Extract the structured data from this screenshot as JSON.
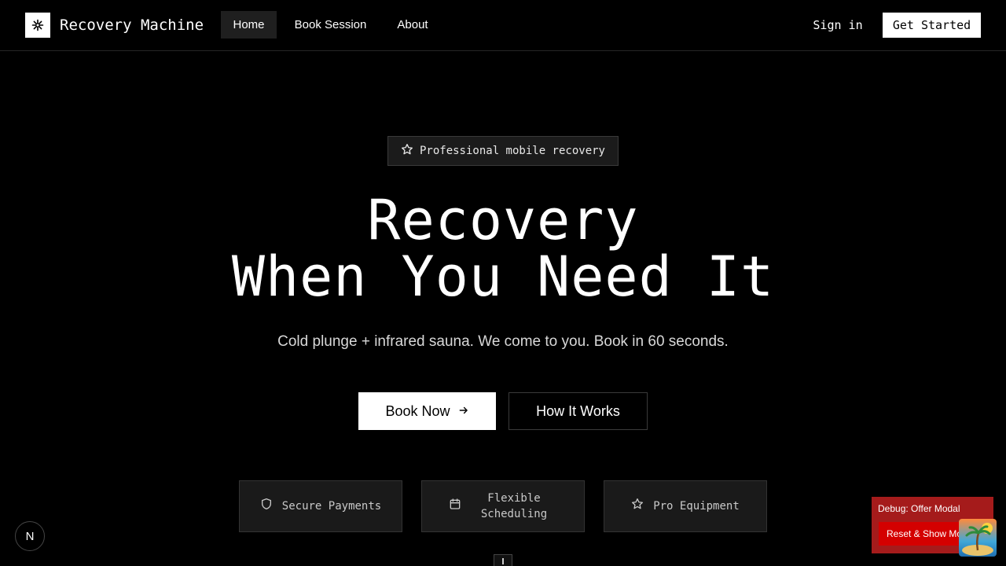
{
  "header": {
    "brand": "Recovery Machine",
    "nav": [
      {
        "label": "Home",
        "active": true
      },
      {
        "label": "Book Session"
      },
      {
        "label": "About"
      }
    ],
    "sign_in": "Sign in",
    "get_started": "Get Started"
  },
  "hero": {
    "badge": "Professional mobile recovery",
    "title_line1": "Recovery",
    "title_line2": "When You Need It",
    "subtitle": "Cold plunge + infrared sauna. We come to you. Book in 60 seconds.",
    "primary_cta": "Book Now",
    "secondary_cta": "How It Works"
  },
  "features": [
    {
      "label": "Secure Payments",
      "icon": "shield-icon"
    },
    {
      "label": "Flexible Scheduling",
      "icon": "calendar-icon"
    },
    {
      "label": "Pro Equipment",
      "icon": "star-icon"
    }
  ],
  "devtools": {
    "next_badge": "N"
  },
  "debug": {
    "title": "Debug: Offer Modal",
    "button": "Reset & Show Modal"
  },
  "colors": {
    "background": "#000000",
    "debug_panel": "#a51b1b",
    "debug_button": "#d40000"
  }
}
